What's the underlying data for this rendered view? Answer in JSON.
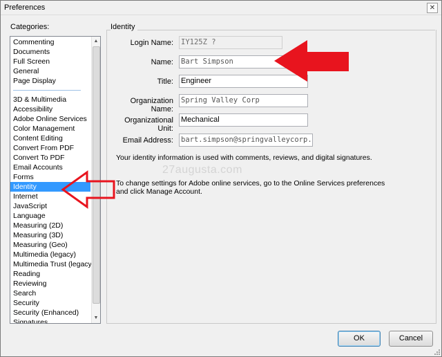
{
  "window": {
    "title": "Preferences",
    "close_glyph": "✕"
  },
  "categories": {
    "label": "Categories:",
    "group1": [
      "Commenting",
      "Documents",
      "Full Screen",
      "General",
      "Page Display"
    ],
    "group2": [
      "3D & Multimedia",
      "Accessibility",
      "Adobe Online Services",
      "Color Management",
      "Content Editing",
      "Convert From PDF",
      "Convert To PDF",
      "Email Accounts",
      "Forms",
      "Identity",
      "Internet",
      "JavaScript",
      "Language",
      "Measuring (2D)",
      "Measuring (3D)",
      "Measuring (Geo)",
      "Multimedia (legacy)",
      "Multimedia Trust (legacy)",
      "Reading",
      "Reviewing",
      "Search",
      "Security",
      "Security (Enhanced)",
      "Signatures"
    ],
    "selected": "Identity"
  },
  "identity": {
    "section_title": "Identity",
    "login_label": "Login Name:",
    "login_value": "IY125Z ?",
    "name_label": "Name:",
    "name_value": "Bart Simpson",
    "title_label": "Title:",
    "title_value": "Engineer",
    "org_label": "Organization Name:",
    "org_value": "Spring Valley Corp",
    "unit_label": "Organizational Unit:",
    "unit_value": "Mechanical",
    "email_label": "Email Address:",
    "email_value": "bart.simpson@springvalleycorp.com",
    "info_text": "Your identity information is used with comments, reviews, and digital signatures.",
    "online_text": "To change settings for Adobe online services, go to the Online Services preferences and click Manage Account."
  },
  "watermark": "27augusta.com",
  "buttons": {
    "ok": "OK",
    "cancel": "Cancel"
  },
  "colors": {
    "selection": "#3399ff",
    "annotation_arrow": "#e8141e"
  }
}
